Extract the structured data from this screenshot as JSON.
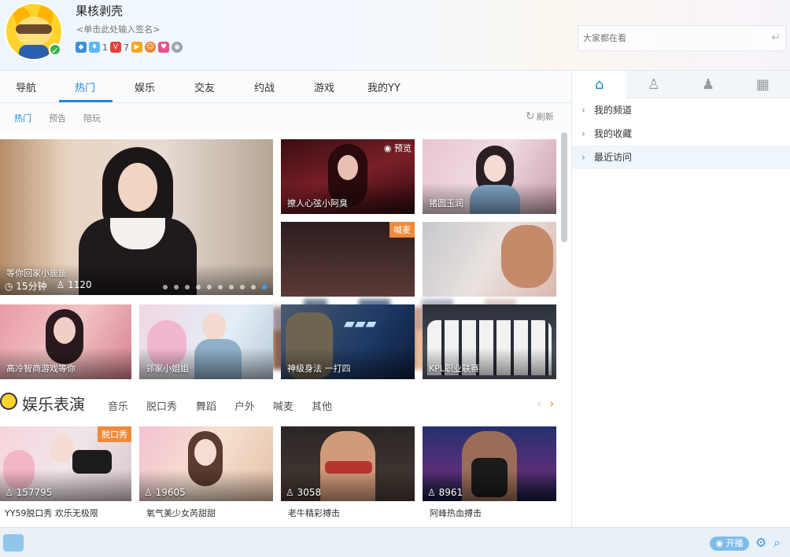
{
  "user": {
    "nickname": "果核剥壳",
    "signature": "<单击此处输入签名>",
    "badge_counts": [
      "1",
      "7"
    ]
  },
  "search": {
    "placeholder": "大家都在看"
  },
  "tabs": [
    "导航",
    "热门",
    "娱乐",
    "交友",
    "约战",
    "游戏",
    "我的YY"
  ],
  "active_tab": "热门",
  "subtabs": [
    "热门",
    "预告",
    "陪玩"
  ],
  "refresh_label": "刷新",
  "featured": {
    "title": "等你回家小旎旎",
    "duration": "15分钟",
    "viewers": "1120"
  },
  "tiles": [
    {
      "title": "撩人心弦小阿臭",
      "tag": "预览"
    },
    {
      "title": "猪圆玉润"
    },
    {
      "title": "",
      "tag": "喊麦"
    },
    {
      "title": ""
    },
    {
      "title": "高冷智商游戏等你"
    },
    {
      "title": "邻家小姐姐"
    },
    {
      "title": "神级身法 一打四"
    },
    {
      "title": "KPL职业联赛"
    }
  ],
  "ent_section": {
    "title": "娱乐表演",
    "categories": [
      "音乐",
      "脱口秀",
      "舞蹈",
      "户外",
      "喊麦",
      "其他"
    ]
  },
  "ent_items": [
    {
      "count": "157795",
      "caption": "YY59脱口秀 欢乐无极限",
      "tag": "脱口秀"
    },
    {
      "count": "19605",
      "caption": "氧气美少女芮甜甜"
    },
    {
      "count": "3058",
      "caption": "老牛精彩搏击"
    },
    {
      "count": "8961",
      "caption": "阿峰热血搏击"
    }
  ],
  "right_panel": {
    "items": [
      "我的频道",
      "我的收藏",
      "最近访问"
    ]
  },
  "footer": {
    "live_label": "开播"
  },
  "colors": {
    "accent": "#1e8ad6",
    "tag_orange": "#f08a3a"
  }
}
